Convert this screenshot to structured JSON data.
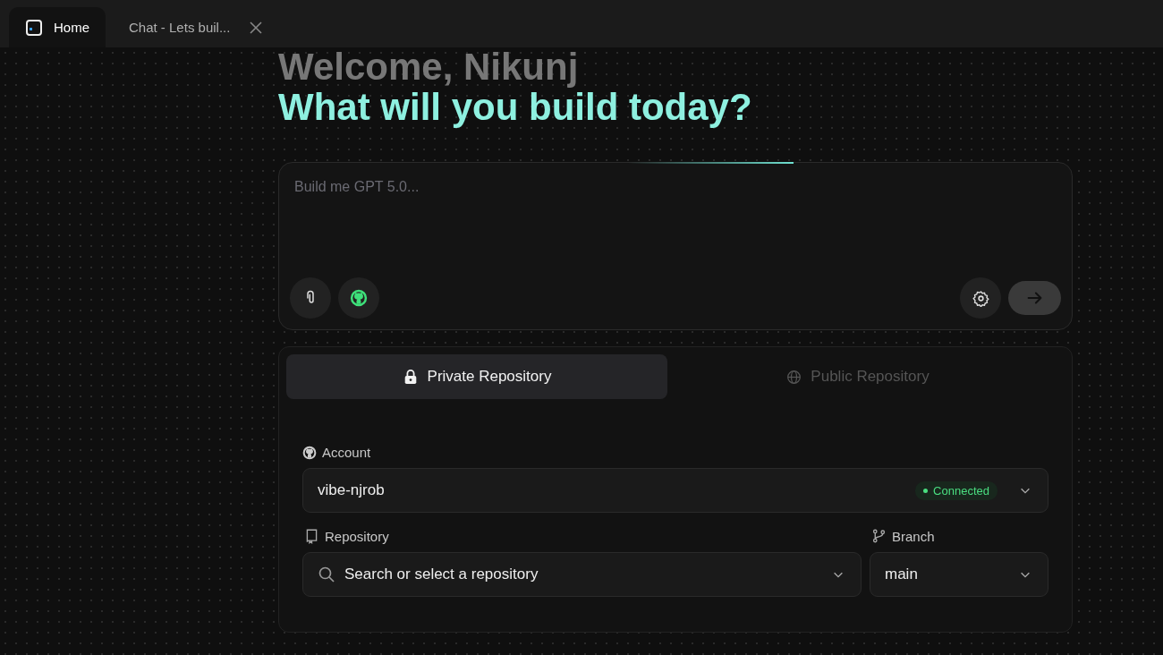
{
  "tabs": [
    {
      "label": "Home",
      "selected": true,
      "kind": "home"
    },
    {
      "label": "Chat - Lets buil...",
      "selected": false,
      "kind": "chat"
    }
  ],
  "greeting": "Welcome, Nikunj",
  "headline": "What will you build today?",
  "prompt": {
    "placeholder": "Build me GPT 5.0..."
  },
  "repo_tabs": [
    {
      "label": "Private Repository",
      "selected": true,
      "kind": "lock"
    },
    {
      "label": "Public Repository",
      "selected": false,
      "kind": "globe"
    }
  ],
  "account": {
    "label": "Account",
    "value": "vibe-njrob",
    "status": "Connected",
    "connected": true
  },
  "repository": {
    "label": "Repository",
    "placeholder": "Search or select a repository"
  },
  "branch": {
    "label": "Branch",
    "value": "main"
  }
}
